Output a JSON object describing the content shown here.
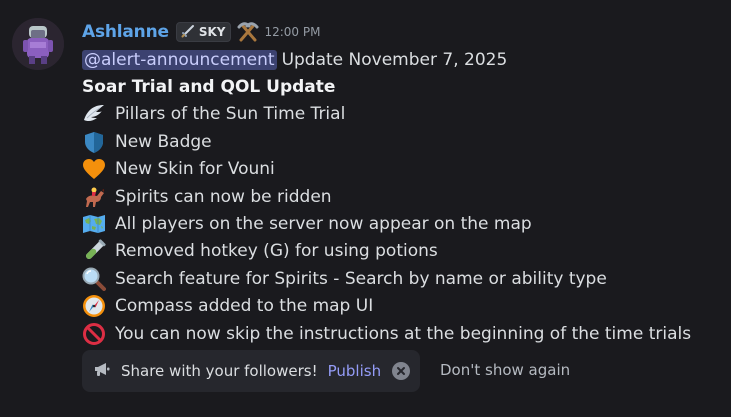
{
  "author": {
    "username": "Ashlanne",
    "tag": "SKY",
    "tag_icon": "sword-icon",
    "role_icon": "pickaxe-icon",
    "timestamp": "12:00 PM"
  },
  "message": {
    "mention": "@alert-announcement",
    "intro": "Update November 7, 2025",
    "title": "Soar Trial and QOL Update",
    "items": [
      {
        "icon": "wing-icon",
        "text": "Pillars of the Sun Time Trial"
      },
      {
        "icon": "blue-shield-icon",
        "text": "New Badge"
      },
      {
        "icon": "orange-heart-icon",
        "text": "New Skin for Vouni"
      },
      {
        "icon": "horse-racing-icon",
        "text": "Spirits can now be ridden"
      },
      {
        "icon": "world-map-icon",
        "text": "All players on the server now appear on the map"
      },
      {
        "icon": "test-tube-icon",
        "text": "Removed hotkey (G) for using potions"
      },
      {
        "icon": "magnifying-glass-icon",
        "text": "Search feature for Spirits - Search by name or ability type"
      },
      {
        "icon": "compass-icon",
        "text": "Compass added to the map UI"
      },
      {
        "icon": "prohibited-icon",
        "text": "You can now skip the instructions at the beginning of the time trials"
      }
    ]
  },
  "share_prompt": {
    "icon": "megaphone-icon",
    "text": "Share with your followers!",
    "publish_label": "Publish",
    "dismiss_label": "Don't show again"
  },
  "colors": {
    "background": "#1a1a1e",
    "username": "#5ea4e8",
    "mention_bg": "#3c4270",
    "link": "#949cf7"
  }
}
